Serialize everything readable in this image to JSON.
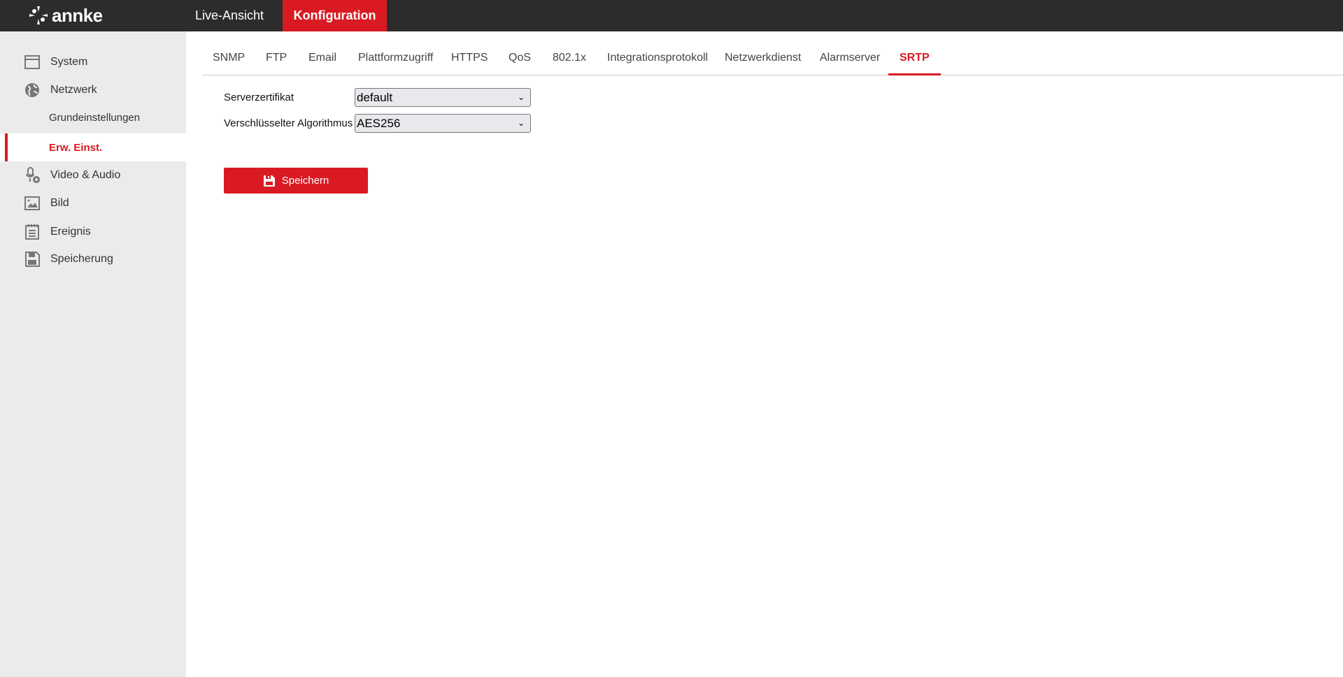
{
  "header": {
    "logo": "annke",
    "nav": [
      {
        "label": "Live-Ansicht"
      },
      {
        "label": "Konfiguration",
        "active": true
      }
    ]
  },
  "sidebar": {
    "items": [
      {
        "label": "System",
        "icon": "window-icon"
      },
      {
        "label": "Netzwerk",
        "icon": "globe-icon"
      },
      {
        "label": "Grundeinstellungen"
      },
      {
        "label": "Erw. Einst.",
        "active": true
      },
      {
        "label": "Video & Audio",
        "icon": "microphone-camera-icon"
      },
      {
        "label": "Bild",
        "icon": "image-icon"
      },
      {
        "label": "Ereignis",
        "icon": "calendar-list-icon"
      },
      {
        "label": "Speicherung",
        "icon": "floppy-icon"
      }
    ]
  },
  "tabs": [
    "SNMP",
    "FTP",
    "Email",
    "Plattformzugriff",
    "HTTPS",
    "QoS",
    "802.1x",
    "Integrationsprotokoll",
    "Netzwerkdienst",
    "Alarmserver",
    "SRTP"
  ],
  "active_tab": "SRTP",
  "form": {
    "server_cert_label": "Serverzertifikat",
    "server_cert_value": "default",
    "algorithm_label": "Verschlüsselter Algorithmus",
    "algorithm_value": "AES256",
    "save_label": "Speichern"
  },
  "colors": {
    "accent": "#da1a22",
    "header_bg": "#2c2c2c",
    "sidebar_bg": "#ebebeb"
  }
}
